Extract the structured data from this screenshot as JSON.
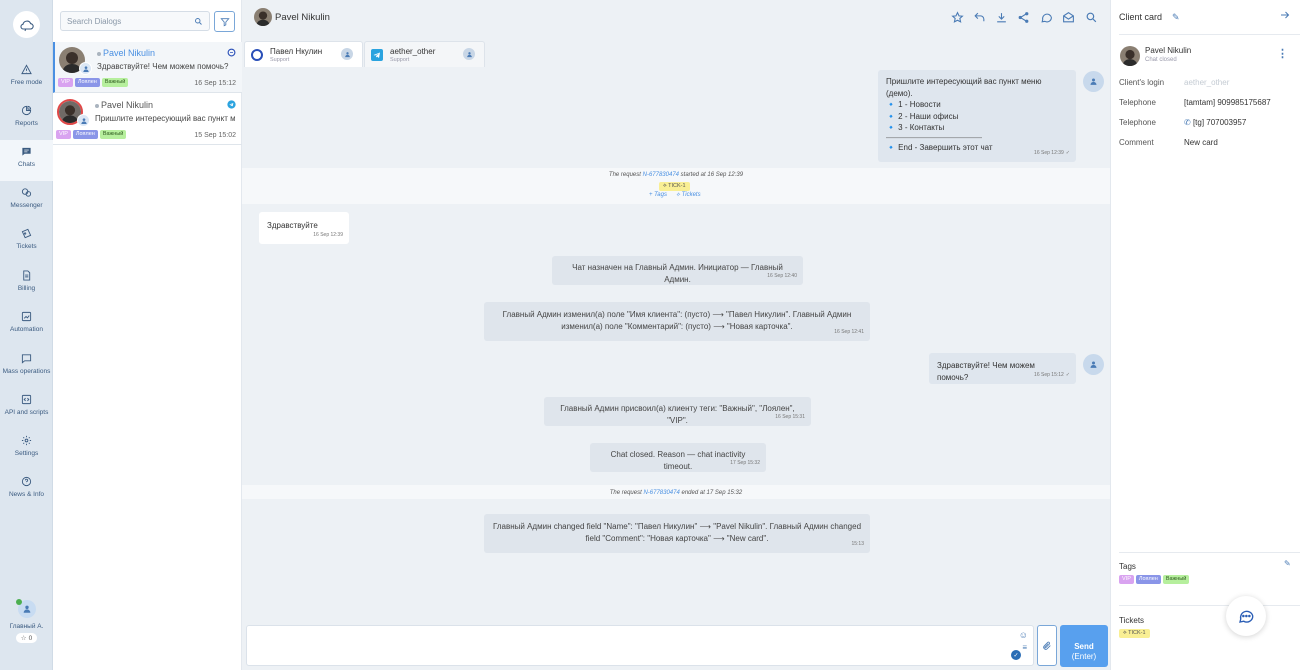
{
  "nav": {
    "items": [
      {
        "label": "Free mode",
        "icon": "warning-icon"
      },
      {
        "label": "Reports",
        "icon": "pie-chart-icon"
      },
      {
        "label": "Chats",
        "icon": "chat-icon"
      },
      {
        "label": "Messenger",
        "icon": "messenger-icon"
      },
      {
        "label": "Tickets",
        "icon": "ticket-icon"
      },
      {
        "label": "Billing",
        "icon": "document-icon"
      },
      {
        "label": "Automation",
        "icon": "automation-icon"
      },
      {
        "label": "Mass operations",
        "icon": "broadcast-icon"
      },
      {
        "label": "API and scripts",
        "icon": "code-icon"
      },
      {
        "label": "Settings",
        "icon": "gear-icon"
      },
      {
        "label": "News & Info",
        "icon": "help-icon"
      }
    ],
    "active": "Chats",
    "user_name": "Главный А.",
    "rating": "0"
  },
  "dialogs": {
    "search_placeholder": "Search Dialogs",
    "items": [
      {
        "name": "Pavel Nikulin",
        "message": "Здравствуйте! Чем можем помочь?",
        "time": "16 Sep 15:12",
        "tags": [
          "VIP",
          "Лоялен",
          "Важный"
        ],
        "channel": "online-chat"
      },
      {
        "name": "Pavel Nikulin",
        "message": "Пришлите интересующий вас пункт меню (демо).",
        "time": "15 Sep 15:02",
        "tags": [
          "VIP",
          "Лоялен",
          "Важный"
        ],
        "channel": "telegram"
      }
    ]
  },
  "chat": {
    "title": "Pavel Nikulin",
    "tabs": [
      {
        "title": "Павел Нкулин",
        "sub": "Support"
      },
      {
        "title": "aether_other",
        "sub": "Support"
      }
    ],
    "messages": {
      "m1_lines": [
        "Пришлите интересующий вас пункт меню (демо).",
        "🔹 1 - Новости",
        "🔹 2 - Наши офисы",
        "🔹 3 - Контакты",
        "————————————",
        "🔹 End - Завершить этот чат"
      ],
      "m1_time": "16 Sep 12:39",
      "req_start_pre": "The request",
      "req_id": "N-677830474",
      "req_start_post": "started at 16 Sep 12:39",
      "ticket_chip": "TICK-1",
      "tags_link": "Tags",
      "tickets_link": "Tickets",
      "m2_text": "Здравствуйте",
      "m2_time": "16 Sep 12:39",
      "s1_text": "Чат назначен на Главный Админ. Инициатор — Главный Админ.",
      "s1_time": "16 Sep 12:40",
      "s2_text": "Главный Админ изменил(а) поле \"Имя клиента\": (пусто) ⟶ \"Павел Никулин\". Главный Админ изменил(а) поле \"Комментарий\": (пусто) ⟶ \"Новая карточка\".",
      "s2_time": "16 Sep 12:41",
      "m3_text": "Здравствуйте! Чем можем помочь?",
      "m3_time": "16 Sep 15:12",
      "s3_text": "Главный Админ присвоил(а) клиенту теги: \"Важный\", \"Лоялен\", \"VIP\".",
      "s3_time": "16 Sep 15:31",
      "s4_text": "Chat closed. Reason — chat inactivity timeout.",
      "s4_time": "17 Sep 15:32",
      "req_end_pre": "The request",
      "req_end_post": "ended at 17 Sep 15:32",
      "s5_text": "Главный Админ changed field \"Name\": \"Павел Никулин\" ⟶ \"Pavel Nikulin\". Главный Админ changed field \"Comment\": \"Новая карточка\" ⟶ \"New card\".",
      "s5_time": "15:13"
    },
    "send_label": "Send",
    "send_hint": "(Enter)"
  },
  "card": {
    "title": "Client card",
    "name": "Pavel Nikulin",
    "status": "Chat closed",
    "login_label": "Client's login",
    "login_value": "aether_other",
    "tel_label": "Telephone",
    "tel1": "[tamtam] 909985175687",
    "tel2_label": "Telephone",
    "tel2": "[tg] 707003957",
    "comment_label": "Comment",
    "comment": "New card",
    "tags_label": "Tags",
    "tags": [
      "VIP",
      "Лоялен",
      "Важный"
    ],
    "tickets_label": "Tickets",
    "ticket": "TICK-1"
  },
  "colors": {
    "accent": "#4a90e2",
    "send": "#58a0ee",
    "nav_bg": "#dde6ef",
    "chat_bg": "#edf1f5"
  }
}
